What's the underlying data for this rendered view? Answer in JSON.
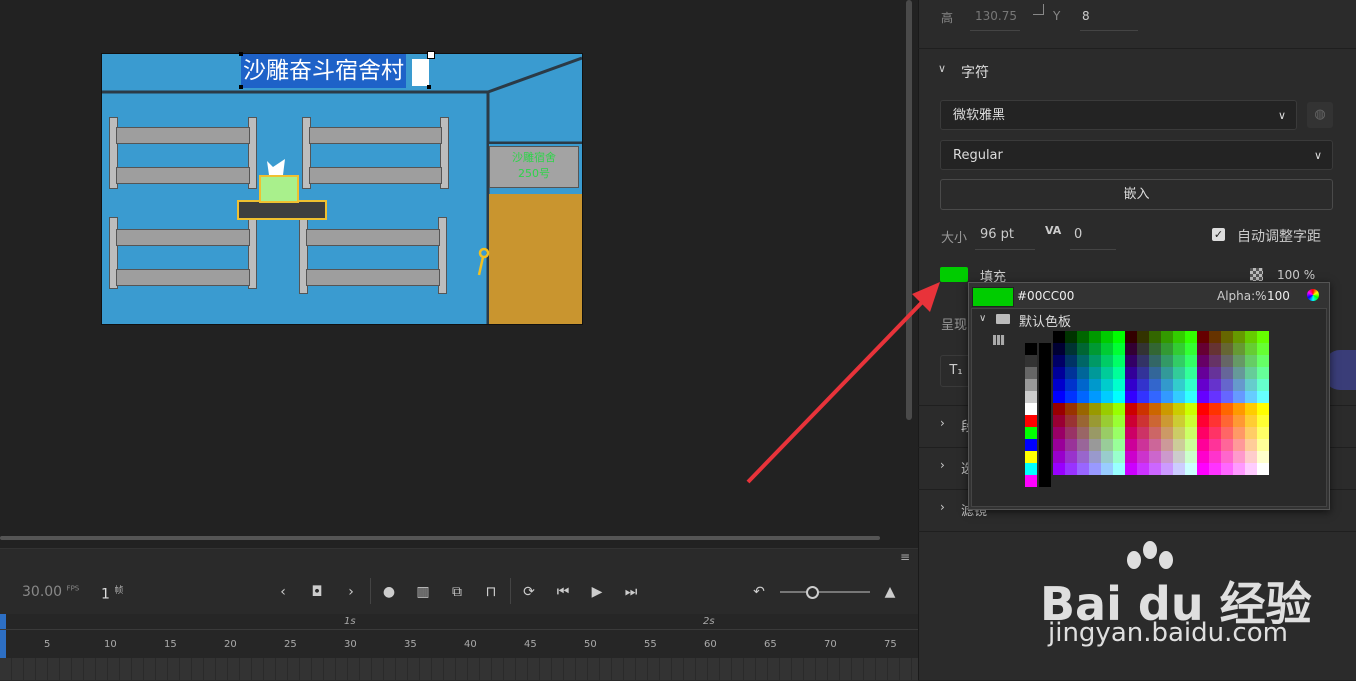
{
  "stage": {
    "title_text": "沙雕奋斗宿舍村",
    "sign_line1": "沙雕宿舍",
    "sign_line2": "250号"
  },
  "timeline": {
    "fps_value": "30.00",
    "fps_unit": "FPS",
    "frame_value": "1",
    "frame_unit": "帧",
    "ruler_marks": [
      "5",
      "10",
      "15",
      "20",
      "25",
      "30",
      "35",
      "40",
      "45",
      "50",
      "55",
      "60",
      "65",
      "70",
      "75"
    ],
    "time_marks": [
      "1s",
      "2s"
    ]
  },
  "panel": {
    "height_label": "高",
    "height_value": "130.75",
    "y_label": "Y",
    "y_value": "8",
    "section_character": "字符",
    "font_family": "微软雅黑",
    "font_style": "Regular",
    "embed_button": "嵌入",
    "size_label": "大小",
    "size_value": "96 pt",
    "tracking_value": "0",
    "auto_kern_label": "自动调整字距",
    "fill_label": "填充",
    "fill_alpha": "100 %",
    "render_label": "呈现",
    "collapsed_sections": [
      "段",
      "选",
      "滤镜"
    ]
  },
  "picker": {
    "hex_value": "#00CC00",
    "alpha_label": "Alpha:%",
    "alpha_value": "100",
    "palette_name": "默认色板"
  },
  "colors": {
    "fill": "#00cc00",
    "stage_bg": "#3a9bd0",
    "selection": "#1e62c8",
    "arrow": "#e8333a"
  },
  "watermark": {
    "brand": "Bai du 经验",
    "url": "jingyan.baidu.com"
  }
}
